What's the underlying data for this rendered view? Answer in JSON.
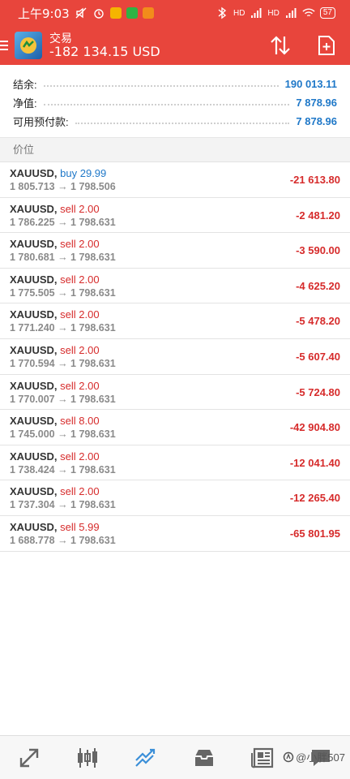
{
  "status_bar": {
    "time": "上午9:03",
    "battery": "57",
    "signal_labels": [
      "HD",
      "HD"
    ]
  },
  "header": {
    "title": "交易",
    "pnl": "-182 134.15 USD"
  },
  "summary": [
    {
      "label": "结余:",
      "value": "190 013.11"
    },
    {
      "label": "净值:",
      "value": "7 878.96"
    },
    {
      "label": "可用预付款:",
      "value": "7 878.96"
    }
  ],
  "section_title": "价位",
  "positions": [
    {
      "symbol": "XAUUSD,",
      "direction": "buy",
      "volume": "29.99",
      "prices": "1 805.713 → 1 798.506",
      "profit": "-21 613.80"
    },
    {
      "symbol": "XAUUSD,",
      "direction": "sell",
      "volume": "2.00",
      "prices": "1 786.225 → 1 798.631",
      "profit": "-2 481.20"
    },
    {
      "symbol": "XAUUSD,",
      "direction": "sell",
      "volume": "2.00",
      "prices": "1 780.681 → 1 798.631",
      "profit": "-3 590.00"
    },
    {
      "symbol": "XAUUSD,",
      "direction": "sell",
      "volume": "2.00",
      "prices": "1 775.505 → 1 798.631",
      "profit": "-4 625.20"
    },
    {
      "symbol": "XAUUSD,",
      "direction": "sell",
      "volume": "2.00",
      "prices": "1 771.240 → 1 798.631",
      "profit": "-5 478.20"
    },
    {
      "symbol": "XAUUSD,",
      "direction": "sell",
      "volume": "2.00",
      "prices": "1 770.594 → 1 798.631",
      "profit": "-5 607.40"
    },
    {
      "symbol": "XAUUSD,",
      "direction": "sell",
      "volume": "2.00",
      "prices": "1 770.007 → 1 798.631",
      "profit": "-5 724.80"
    },
    {
      "symbol": "XAUUSD,",
      "direction": "sell",
      "volume": "8.00",
      "prices": "1 745.000 → 1 798.631",
      "profit": "-42 904.80"
    },
    {
      "symbol": "XAUUSD,",
      "direction": "sell",
      "volume": "2.00",
      "prices": "1 738.424 → 1 798.631",
      "profit": "-12 041.40"
    },
    {
      "symbol": "XAUUSD,",
      "direction": "sell",
      "volume": "2.00",
      "prices": "1 737.304 → 1 798.631",
      "profit": "-12 265.40"
    },
    {
      "symbol": "XAUUSD,",
      "direction": "sell",
      "volume": "5.99",
      "prices": "1 688.778 → 1 798.631",
      "profit": "-65 801.95"
    }
  ],
  "bottom_nav": [
    "quotes-icon",
    "chart-icon",
    "trade-icon",
    "history-icon",
    "news-icon",
    "chat-icon"
  ],
  "watermark": "@小胖507",
  "colors": {
    "header_bg": "#e8453c",
    "loss": "#d62b2b",
    "buy": "#1f78c8",
    "value_blue": "#1f78c8",
    "active_nav": "#3b8fd8"
  }
}
